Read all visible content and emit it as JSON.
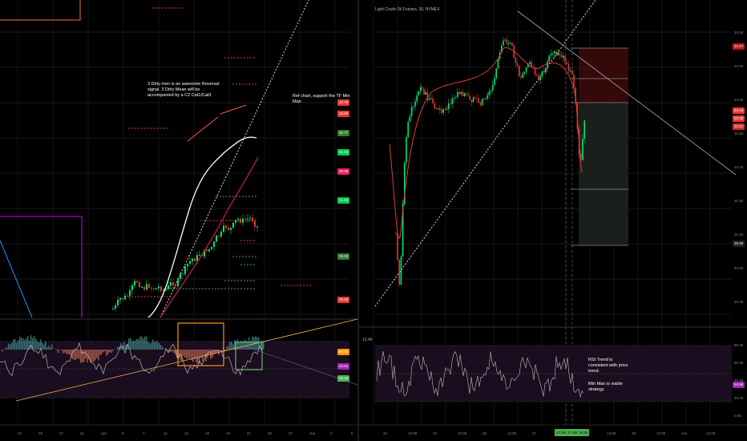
{
  "left_pane": {
    "note_reversal": "3 Dirty men is an awesome Reversal\nsignal. 3 Dirty Mean will be\naccompanied by a C2 Cat1/Cat3",
    "note_ref": "Ref chart, support the TF Mtn Man",
    "x_ticks": [
      "22",
      "28",
      "27",
      "31",
      "Apr",
      "5",
      "7",
      "11",
      "13",
      "15",
      "19",
      "21",
      "25",
      "27",
      "Jun",
      "3",
      "5"
    ],
    "price_tags": [
      {
        "text": "32.78",
        "color": "#e53935"
      },
      {
        "text": "33.80",
        "color": "#e53935"
      },
      {
        "text": "30.77",
        "color": "#2e7d32"
      },
      {
        "text": "31.36",
        "color": "#00c853"
      },
      {
        "text": "30.00",
        "color": "#e91e63"
      },
      {
        "text": "31.00",
        "color": "#00c853"
      },
      {
        "text": "29.00",
        "color": "#2e7d32"
      },
      {
        "text": "26.00",
        "color": "#e53935"
      }
    ],
    "ind_tags": [
      {
        "text": "80.00",
        "color": "#ff9800"
      },
      {
        "text": "63.81",
        "color": "#9c27b0"
      },
      {
        "text": "48.18",
        "color": "#4caf50"
      }
    ]
  },
  "right_pane": {
    "title": "Light Crude Oil Futures, 30, NYMEX",
    "note_rsi": "RSI Trend is\nconsistent with price\ntrend.",
    "note_mtn": "Mtn Man is viable\nstrategy",
    "y_ticks": [
      "34.00",
      "33.50",
      "33.00",
      "32.50",
      "32.00",
      "31.50",
      "31.00",
      "30.50",
      "30.00"
    ],
    "ind_ticks": [
      "80.00",
      "60.00",
      "40.00",
      "20.00",
      "0.00"
    ],
    "ind_label": "13.49",
    "x_ticks": [
      "22",
      "12:00",
      "23",
      "12:00",
      "26",
      "12:00",
      "27",
      "12:00",
      "28",
      "12:00",
      "29",
      "12:00",
      "Jun",
      "12:00"
    ],
    "date_badges": [
      "27 May '20",
      "27 May '20",
      "15:30"
    ],
    "price_tags": [
      {
        "text": "34.27",
        "color": "#b71c1c"
      },
      {
        "text": "33.44",
        "color": "#e53935"
      },
      {
        "text": "33.40",
        "color": "#e53935"
      },
      {
        "text": "32.61",
        "color": "#d32f2f"
      },
      {
        "text": "30.00",
        "color": "#222222"
      }
    ],
    "ind_tags": [
      {
        "text": "64.98",
        "color": "#9c27b0"
      }
    ]
  }
}
